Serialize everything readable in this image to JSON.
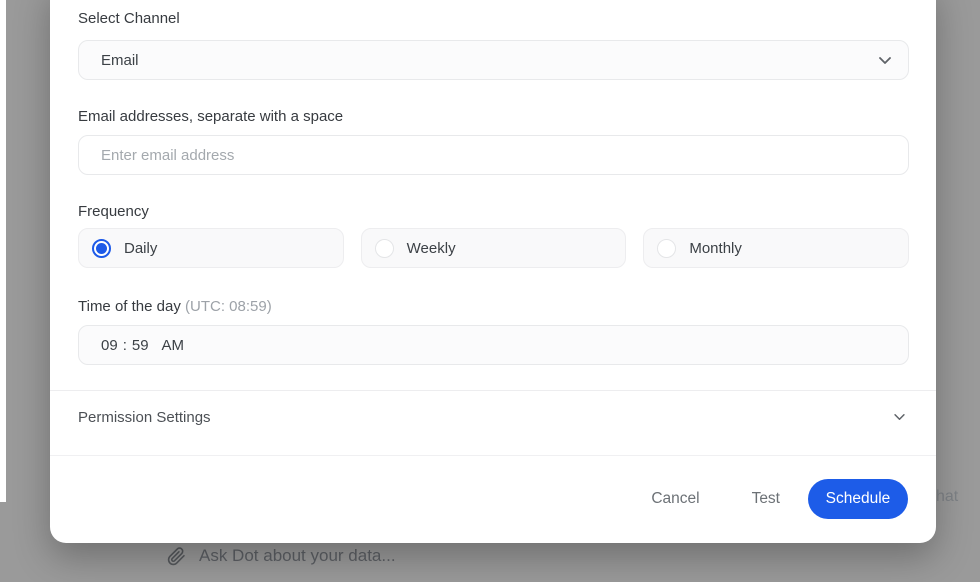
{
  "modal": {
    "channel": {
      "label": "Select Channel",
      "value": "Email"
    },
    "email": {
      "label": "Email addresses, separate with a space",
      "placeholder": "Enter email address"
    },
    "frequency": {
      "label": "Frequency",
      "options": [
        {
          "label": "Daily",
          "selected": true
        },
        {
          "label": "Weekly",
          "selected": false
        },
        {
          "label": "Monthly",
          "selected": false
        }
      ]
    },
    "time": {
      "label": "Time of the day",
      "utc_note": "(UTC: 08:59)",
      "hour": "09",
      "separator": ":",
      "minute": "59",
      "meridiem": "AM"
    },
    "permissions": {
      "label": "Permission Settings"
    },
    "footer": {
      "cancel_label": "Cancel",
      "test_label": "Test",
      "schedule_label": "Schedule"
    }
  },
  "background": {
    "chat_placeholder": "Ask Dot about your data...",
    "partial_text": "hat"
  },
  "colors": {
    "accent_blue": "#1d5ce8",
    "overlay_gray": "#9a9a9a"
  }
}
